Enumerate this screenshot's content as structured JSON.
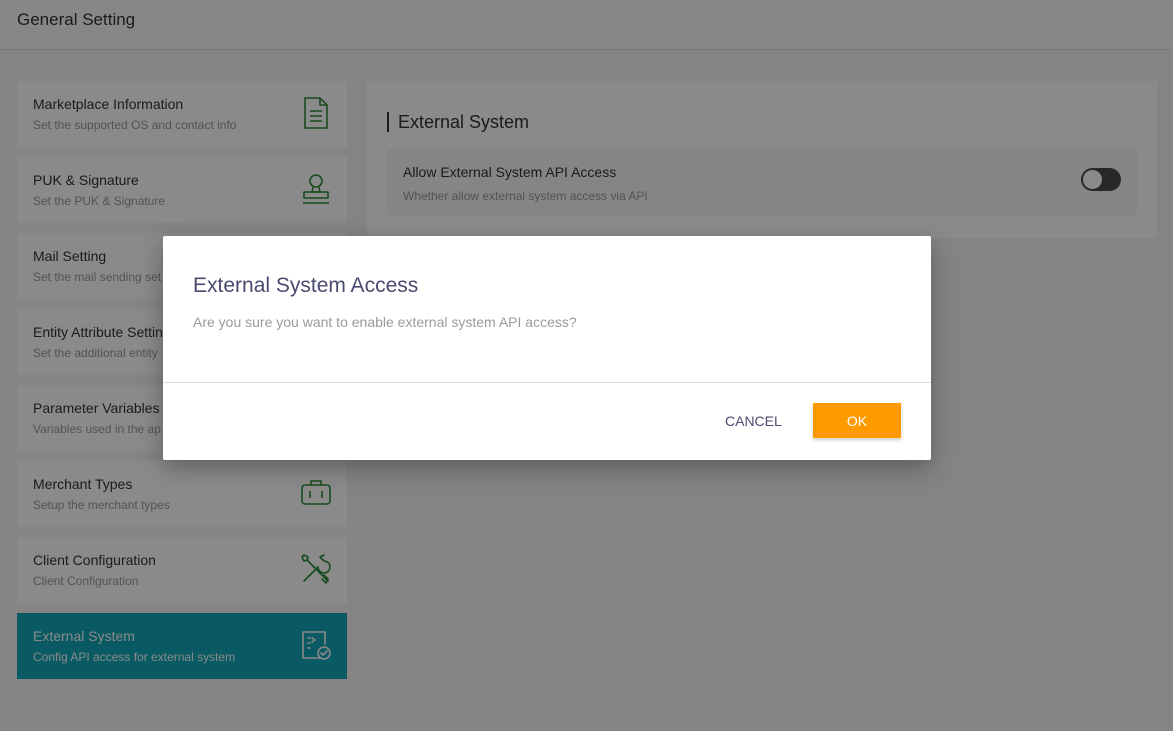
{
  "header": {
    "title": "General Setting"
  },
  "menu": {
    "items": [
      {
        "title": "Marketplace Information",
        "desc": "Set the supported OS and contact info",
        "icon": "document-icon"
      },
      {
        "title": "PUK & Signature",
        "desc": "Set the PUK & Signature",
        "icon": "stamp-icon"
      },
      {
        "title": "Mail Setting",
        "desc": "Set the mail sending set",
        "icon": "mail-icon"
      },
      {
        "title": "Entity Attribute Settin",
        "desc": "Set the additional entity",
        "icon": "attribute-icon"
      },
      {
        "title": "Parameter Variables",
        "desc": "Variables used in the ap",
        "icon": "variables-icon"
      },
      {
        "title": "Merchant Types",
        "desc": "Setup the merchant types",
        "icon": "briefcase-icon"
      },
      {
        "title": "Client Configuration",
        "desc": "Client Configuration",
        "icon": "tools-icon"
      },
      {
        "title": "External System",
        "desc": "Config API access for external system",
        "icon": "api-doc-check-icon"
      }
    ],
    "active_index": 7
  },
  "content": {
    "section_title": "External System",
    "setting": {
      "label": "Allow External System API Access",
      "desc": "Whether allow external system access via API",
      "enabled": false
    }
  },
  "dialog": {
    "title": "External System Access",
    "message": "Are you sure you want to enable external system API access?",
    "cancel_label": "CANCEL",
    "ok_label": "OK"
  },
  "colors": {
    "active_menu": "#12a6b6",
    "icon_green": "#2e8b3a",
    "ok_button": "#fd9a00",
    "dialog_title": "#4a4a70",
    "toggle_off": "#4a4a4a"
  }
}
